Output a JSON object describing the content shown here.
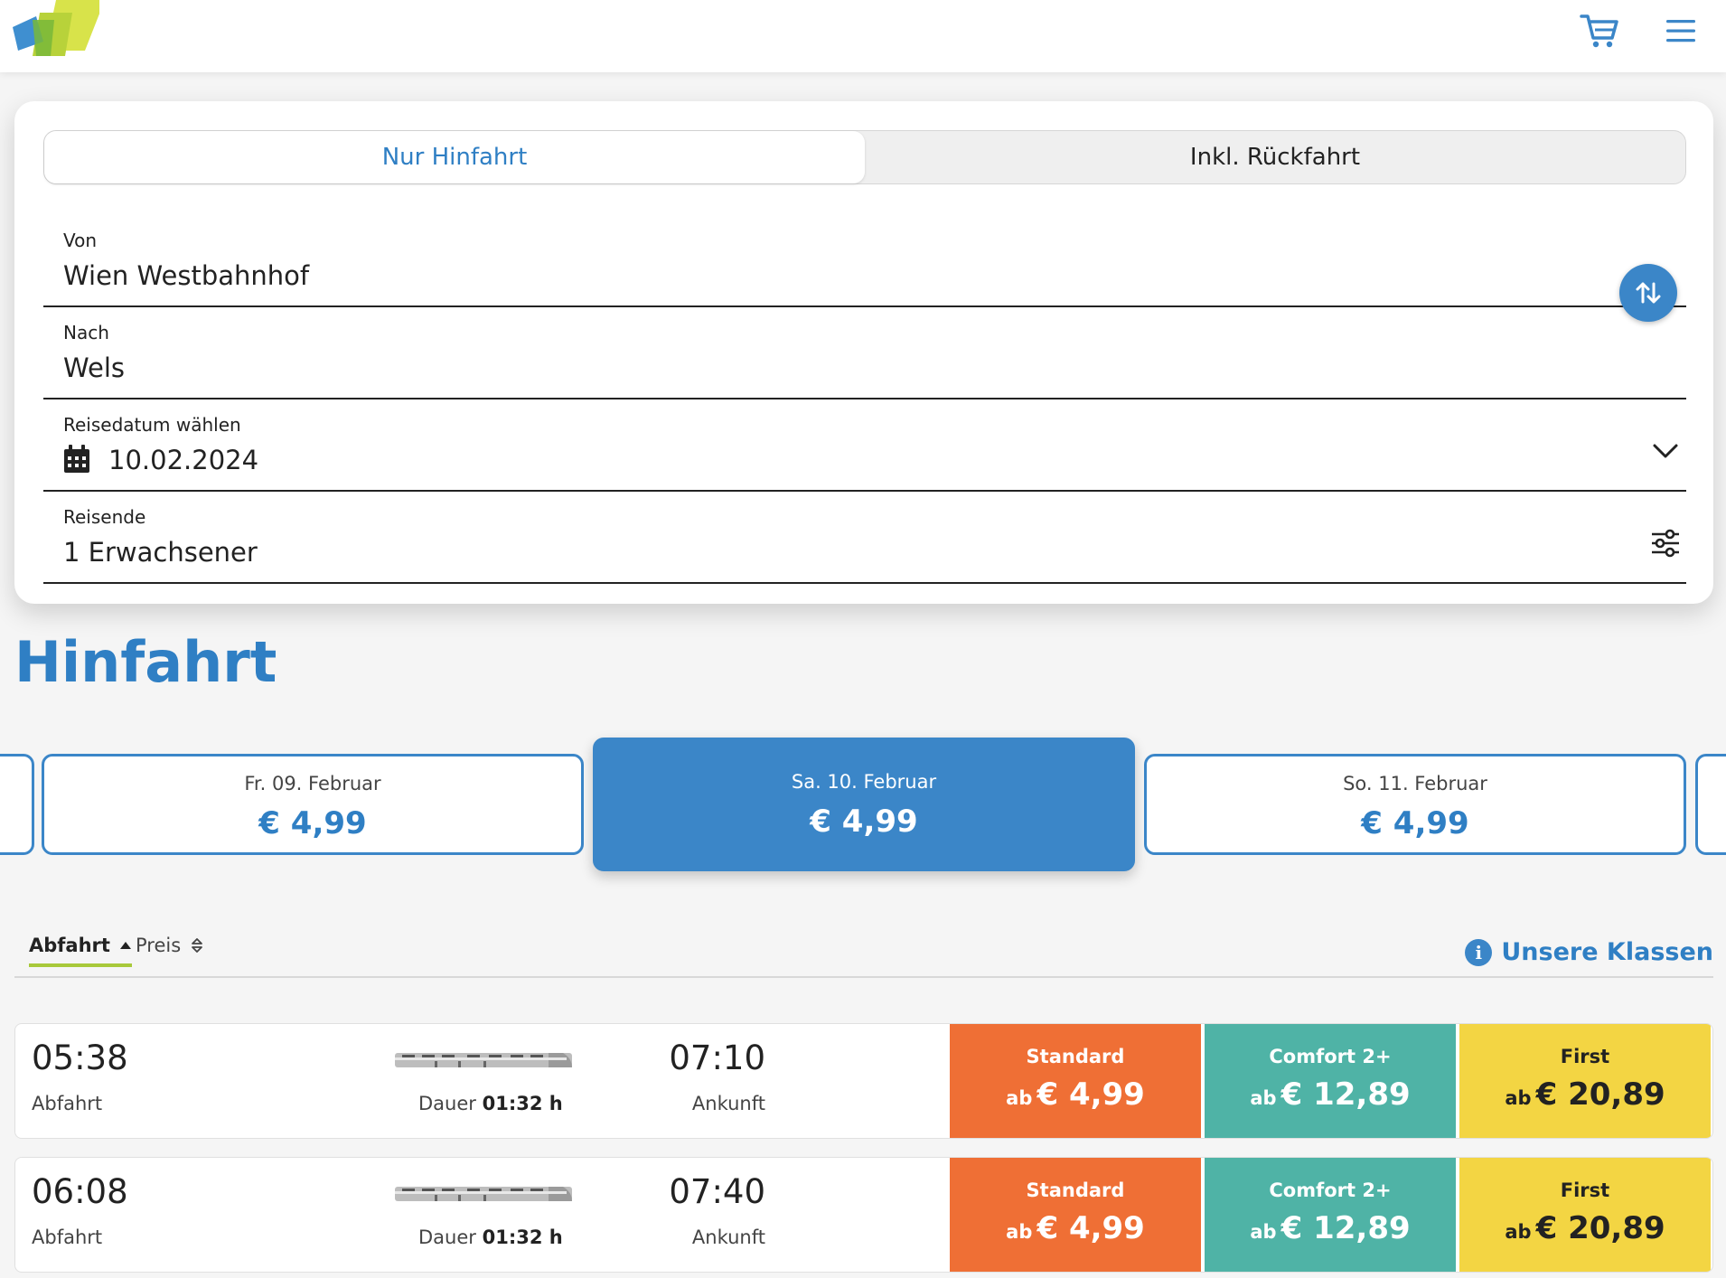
{
  "header": {
    "logo_name": "brand-logo",
    "cart_icon": "cart-icon",
    "menu_icon": "menu-icon"
  },
  "search": {
    "trip_toggle": {
      "one_way": "Nur Hinfahrt",
      "return": "Inkl. Rückfahrt",
      "selected": "Nur Hinfahrt"
    },
    "from": {
      "label": "Von",
      "value": "Wien Westbahnhof"
    },
    "to": {
      "label": "Nach",
      "value": "Wels"
    },
    "date": {
      "label": "Reisedatum wählen",
      "value": "10.02.2024"
    },
    "travellers": {
      "label": "Reisende",
      "value": "1 Erwachsener"
    }
  },
  "results": {
    "title": "Hinfahrt",
    "dates": [
      {
        "day": "Fr. 09. Februar",
        "price": "€ 4,99",
        "selected": false
      },
      {
        "day": "Sa. 10. Februar",
        "price": "€ 4,99",
        "selected": true
      },
      {
        "day": "So. 11. Februar",
        "price": "€ 4,99",
        "selected": false
      }
    ],
    "sort": {
      "departure": "Abfahrt",
      "price": "Preis"
    },
    "classes_link": "Unsere Klassen",
    "connections": [
      {
        "departure": "05:38",
        "departure_label": "Abfahrt",
        "duration_label": "Dauer",
        "duration": "01:32 h",
        "arrival": "07:10",
        "arrival_label": "Ankunft",
        "fares": [
          {
            "class": "Standard",
            "prefix": "ab",
            "price": "€ 4,99"
          },
          {
            "class": "Comfort 2+",
            "prefix": "ab",
            "price": "€ 12,89"
          },
          {
            "class": "First",
            "prefix": "ab",
            "price": "€ 20,89"
          }
        ]
      },
      {
        "departure": "06:08",
        "departure_label": "Abfahrt",
        "duration_label": "Dauer",
        "duration": "01:32 h",
        "arrival": "07:40",
        "arrival_label": "Ankunft",
        "fares": [
          {
            "class": "Standard",
            "prefix": "ab",
            "price": "€ 4,99"
          },
          {
            "class": "Comfort 2+",
            "prefix": "ab",
            "price": "€ 12,89"
          },
          {
            "class": "First",
            "prefix": "ab",
            "price": "€ 20,89"
          }
        ]
      }
    ]
  },
  "colors": {
    "primary": "#3b86c8",
    "standard": "#ef6f35",
    "comfort": "#4fb3a6",
    "first": "#f3d543",
    "sort_underline": "#a8c93a"
  }
}
